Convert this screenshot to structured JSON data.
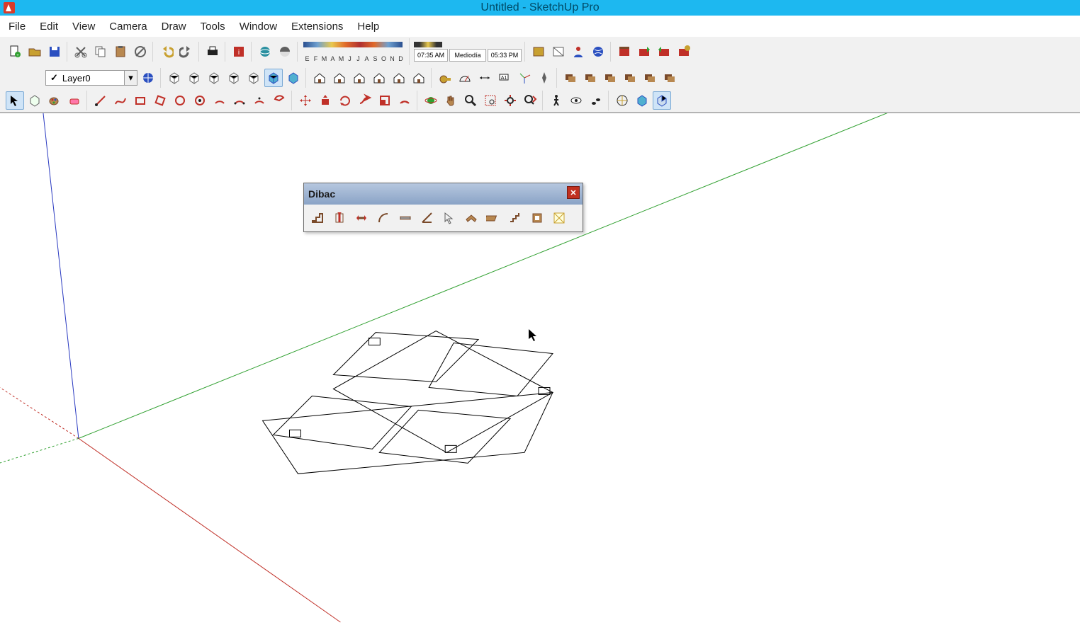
{
  "title": "Untitled - SketchUp Pro",
  "menu": [
    "File",
    "Edit",
    "View",
    "Camera",
    "Draw",
    "Tools",
    "Window",
    "Extensions",
    "Help"
  ],
  "layer": {
    "name": "Layer0"
  },
  "months": [
    "E",
    "F",
    "M",
    "A",
    "M",
    "J",
    "J",
    "A",
    "S",
    "O",
    "N",
    "D"
  ],
  "time": {
    "sunrise": "07:35 AM",
    "noon": "Mediodía",
    "sunset": "05:33 PM"
  },
  "dibac": {
    "title": "Dibac"
  },
  "icons": {
    "r1g1": [
      "new-file",
      "open-file",
      "save"
    ],
    "r1g2": [
      "cut",
      "copy",
      "paste",
      "delete"
    ],
    "r1g3": [
      "undo",
      "redo"
    ],
    "r1g4": [
      "print"
    ],
    "r1g5": [
      "model-info"
    ],
    "r1g6": [
      "geo-earth",
      "geo-shade"
    ],
    "r1g7": [
      "open-1",
      "open-2",
      "person",
      "globe"
    ],
    "r1g8": [
      "ext-1",
      "ext-2",
      "ext-3",
      "ext-4"
    ],
    "r2g1": [
      "layer-manager"
    ],
    "r2g2": [
      "view-iso",
      "view-top",
      "view-front",
      "view-back",
      "view-right",
      "view-left",
      "view-persp"
    ],
    "r2g3": [
      "house-1",
      "house-2",
      "house-3",
      "house-4",
      "house-5",
      "house-6"
    ],
    "r2g4": [
      "tape",
      "protractor",
      "dim",
      "text",
      "axes",
      "compass"
    ],
    "r2g5": [
      "gr-1",
      "gr-2",
      "gr-3",
      "gr-4",
      "gr-5",
      "gr-6"
    ],
    "r3g1": [
      "select",
      "component",
      "paint",
      "eraser"
    ],
    "r3g2": [
      "line",
      "freehand",
      "rect",
      "rotrect",
      "circle",
      "polygon",
      "arc",
      "2ptarc",
      "3ptarc",
      "pie"
    ],
    "r3g3": [
      "move",
      "pushpull",
      "rotate",
      "followme",
      "scale",
      "offset"
    ],
    "r3g4": [
      "orbit",
      "pan",
      "zoom",
      "zoomwin",
      "zoomext",
      "prev"
    ],
    "r3g5": [
      "walk",
      "lookaround",
      "walkthrough"
    ],
    "r3g6": [
      "section",
      "xray",
      "backedges"
    ],
    "dibac": [
      "wall-tool",
      "opening-tool",
      "align-tool",
      "curve-wall",
      "linear-dim",
      "angular-dim",
      "pick",
      "roof",
      "slab",
      "stair",
      "door-window",
      "convert-3d"
    ]
  }
}
